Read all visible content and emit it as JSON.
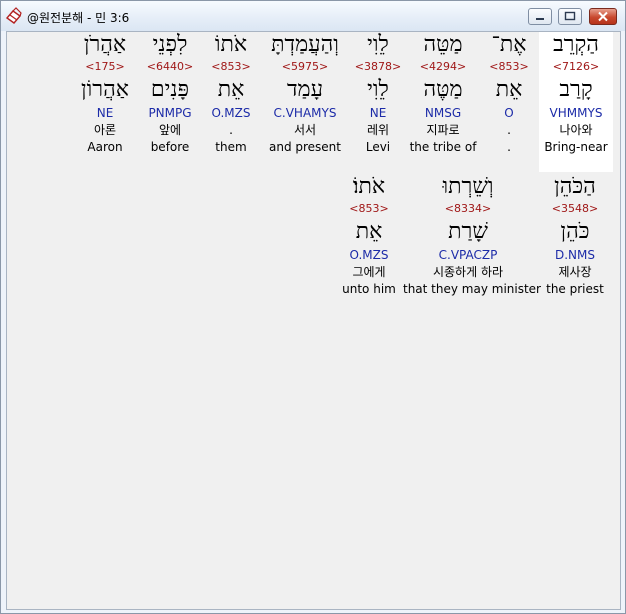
{
  "window": {
    "title": "@원전분해 - 민 3:6",
    "controls": {
      "minimize": "minimize-icon",
      "maximize": "maximize-icon",
      "close": "close-icon"
    }
  },
  "colors": {
    "strong": "#a01818",
    "morph": "#1c2ba8",
    "selected_bg": "#ffffff"
  },
  "rows": [
    {
      "words": [
        {
          "heb": "הַקְרֵב",
          "strong": "<7126>",
          "lemma": "קָרַב",
          "morph": "VHMMYS",
          "kor": "나아와",
          "eng": "Bring-near",
          "selected": true
        },
        {
          "heb": "אֶת־",
          "strong": "<853>",
          "lemma": "אֵת",
          "morph": "O",
          "kor": ".",
          "eng": "."
        },
        {
          "heb": "מַטֵּה",
          "strong": "<4294>",
          "lemma": "מַטֶּה",
          "morph": "NMSG",
          "kor": "지파로",
          "eng": "the tribe of"
        },
        {
          "heb": "לֵוִי",
          "strong": "<3878>",
          "lemma": "לֵוִי",
          "morph": "NE",
          "kor": "레위",
          "eng": "Levi"
        },
        {
          "heb": "וְהַעֲמַדְתָּ",
          "strong": "<5975>",
          "lemma": "עָמַד",
          "morph": "C.VHAMYS",
          "kor": "서서",
          "eng": "and present"
        },
        {
          "heb": "אֹתוֹ",
          "strong": "<853>",
          "lemma": "אֵת",
          "morph": "O.MZS",
          "kor": ".",
          "eng": "them"
        },
        {
          "heb": "לִפְנֵי",
          "strong": "<6440>",
          "lemma": "פָּנִים",
          "morph": "PNMPG",
          "kor": "앞에",
          "eng": "before"
        },
        {
          "heb": "אַהֲרֹן",
          "strong": "<175>",
          "lemma": "אַהֲרוֹן",
          "morph": "NE",
          "kor": "아론",
          "eng": "Aaron"
        }
      ]
    },
    {
      "words": [
        {
          "heb": "הַכֹּהֵן",
          "strong": "<3548>",
          "lemma": "כֹּהֵן",
          "morph": "D.NMS",
          "kor": "제사장",
          "eng": "the priest"
        },
        {
          "heb": "וְשֵׁרְתוּ",
          "strong": "<8334>",
          "lemma": "שָׁרַת",
          "morph": "C.VPACZP",
          "kor": "시종하게 하라",
          "eng": "that they may minister"
        },
        {
          "heb": "אֹתוֹ׃",
          "strong": "<853>",
          "lemma": "אֵת",
          "morph": "O.MZS",
          "kor": "그에게",
          "eng": "unto him"
        }
      ]
    }
  ]
}
